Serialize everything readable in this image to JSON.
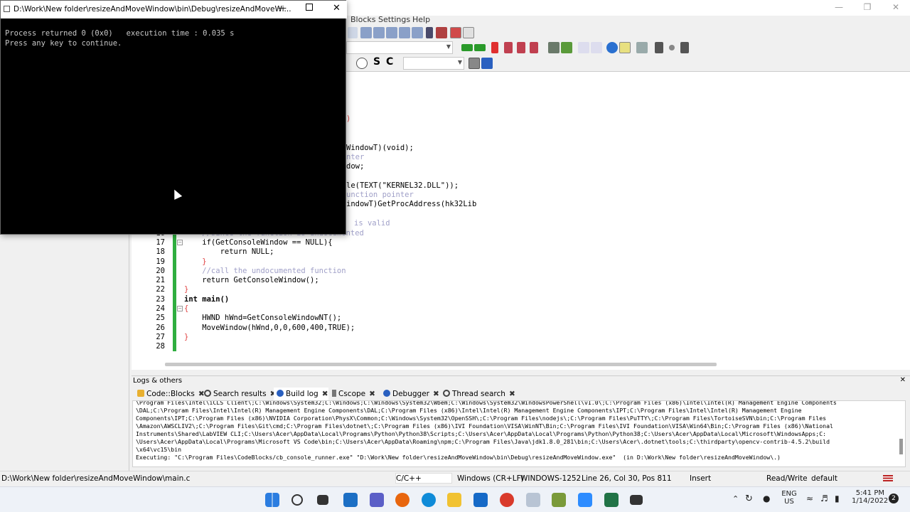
{
  "ide": {
    "menu": [
      "Blocks",
      "Settings",
      "Help"
    ],
    "search_combo_value": "",
    "logs_panel_title": "Logs & others",
    "logs_tabs": [
      {
        "label": "Code::Blocks",
        "icon": "codeblocks-icon"
      },
      {
        "label": "Search results",
        "icon": "search-icon"
      },
      {
        "label": "Build log",
        "icon": "gear-icon"
      },
      {
        "label": "Cscope",
        "icon": "cscope-icon"
      },
      {
        "label": "Debugger",
        "icon": "gear-icon"
      },
      {
        "label": "Thread search",
        "icon": "search-icon"
      }
    ],
    "log_lines": [
      "\\Program Files\\Intel\\iCLS Client\\;C:\\Windows\\System32;C:\\Windows;C:\\Windows\\System32\\Wbem;C:\\Windows\\System32\\WindowsPowerShell\\v1.0\\;C:\\Program Files (x86)\\Intel\\Intel(R) Management Engine Components",
      "\\DAL;C:\\Program Files\\Intel\\Intel(R) Management Engine Components\\DAL;C:\\Program Files (x86)\\Intel\\Intel(R) Management Engine Components\\IPT;C:\\Program Files\\Intel\\Intel(R) Management Engine",
      "Components\\IPT;C:\\Program Files (x86)\\NVIDIA Corporation\\PhysX\\Common;C:\\Windows\\System32\\OpenSSH\\;C:\\Program Files\\nodejs\\;C:\\Program Files\\PuTTY\\;C:\\Program Files\\TortoiseSVN\\bin;C:\\Program Files",
      "\\Amazon\\AWSCLIV2\\;C:\\Program Files\\Git\\cmd;C:\\Program Files\\dotnet\\;C:\\Program Files (x86)\\IVI Foundation\\VISA\\WinNT\\Bin;C:\\Program Files\\IVI Foundation\\VISA\\Win64\\Bin;C:\\Program Files (x86)\\National",
      "Instruments\\Shared\\LabVIEW CLI;C:\\Users\\Acer\\AppData\\Local\\Programs\\Python\\Python38\\Scripts;C:\\Users\\Acer\\AppData\\Local\\Programs\\Python\\Python38;C:\\Users\\Acer\\AppData\\Local\\Microsoft\\WindowsApps;C:",
      "\\Users\\Acer\\AppData\\Local\\Programs\\Microsoft VS Code\\bin;C:\\Users\\Acer\\AppData\\Roaming\\npm;C:\\Program Files\\Java\\jdk1.8.0_281\\bin;C:\\Users\\Acer\\.dotnet\\tools;C:\\thirdparty\\opencv-contrib-4.5.2\\build",
      "\\x64\\vc15\\bin",
      "Executing: \"C:\\Program Files\\CodeBlocks/cb_console_runner.exe\" \"D:\\Work\\New folder\\resizeAndMoveWindow\\bin\\Debug\\resizeAndMoveWindow.exe\"  (in D:\\Work\\New folder\\resizeAndMoveWindow\\.)"
    ],
    "status": {
      "file": "D:\\Work\\New folder\\resizeAndMoveWindow\\main.c",
      "language": "C/C++",
      "eol": "Windows (CR+LF)",
      "encoding": "WINDOWS-1252",
      "position": "Line 26, Col 30, Pos 811",
      "mode": "Insert",
      "access": "Read/Write",
      "profile": "default"
    }
  },
  "code": {
    "visible_partial": [
      {
        "text": ")"
      },
      {
        "text": "WindowT)(void);"
      },
      {
        "text": "nter"
      },
      {
        "text": "dow;"
      },
      {
        "text": "le(TEXT(\"KERNEL32.DLL\"));"
      },
      {
        "text": "unction pointer"
      },
      {
        "text": "indowT)GetProcAddress(hk32Lib"
      },
      {
        "text": "is valid"
      }
    ],
    "lines": [
      {
        "n": "16",
        "text": "    //since the function is undocumented"
      },
      {
        "n": "17",
        "text": "    if(GetConsoleWindow == NULL){"
      },
      {
        "n": "18",
        "text": "        return NULL;"
      },
      {
        "n": "19",
        "text": "    }"
      },
      {
        "n": "20",
        "text": "    //call the undocumented function"
      },
      {
        "n": "21",
        "text": "    return GetConsoleWindow();"
      },
      {
        "n": "22",
        "text": "}"
      },
      {
        "n": "23",
        "text": "int main()"
      },
      {
        "n": "24",
        "text": "{"
      },
      {
        "n": "25",
        "text": "    HWND hWnd=GetConsoleWindowNT();"
      },
      {
        "n": "26",
        "text": "    MoveWindow(hWnd,0,0,600,400,TRUE);"
      },
      {
        "n": "27",
        "text": "}"
      },
      {
        "n": "28",
        "text": ""
      }
    ]
  },
  "console": {
    "title": "D:\\Work\\New folder\\resizeAndMoveWindow\\bin\\Debug\\resizeAndMoveWi...",
    "output": "Process returned 0 (0x0)   execution time : 0.035 s\nPress any key to continue."
  },
  "taskbar": {
    "language": "ENG",
    "region": "US",
    "time": "5:41 PM",
    "date": "1/14/2022",
    "notification_count": "2"
  },
  "colors": {
    "change_bar": "#2fae3f",
    "console_bg": "#000000",
    "taskbar_bg": "#eef2f8",
    "keyword": "#00008b",
    "comment": "#a0a0c8",
    "number": "#d04040"
  }
}
